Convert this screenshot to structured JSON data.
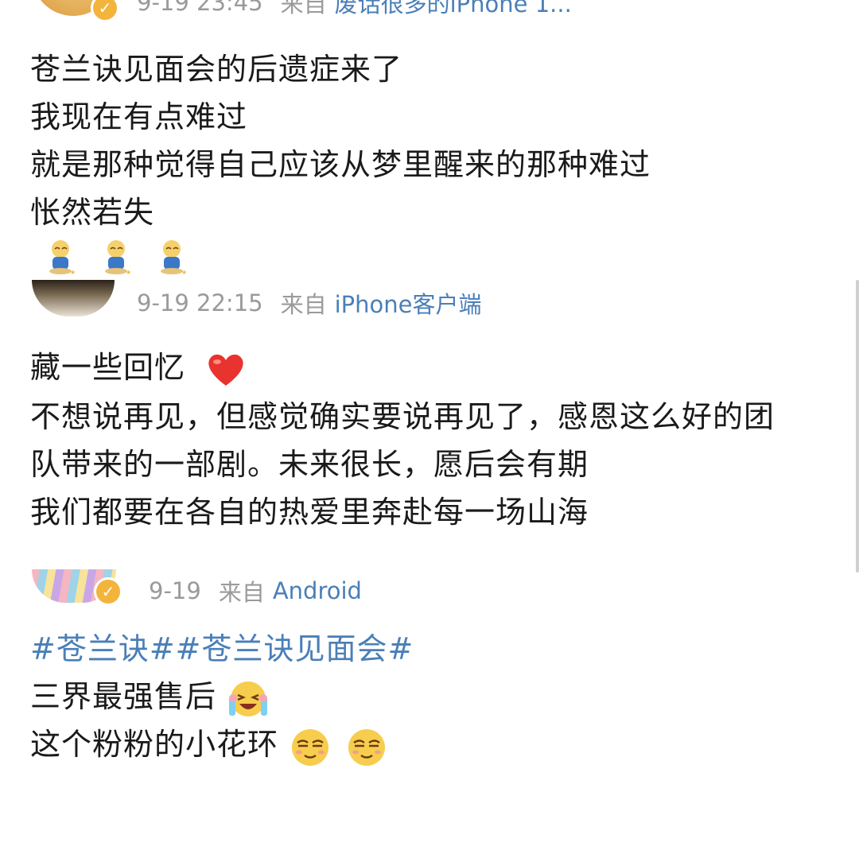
{
  "posts": [
    {
      "time": "9-19 23:45",
      "from": "来自",
      "source": "废话很多的iPhone 1...",
      "verified": true,
      "lines": [
        "苍兰诀见面会的后遗症来了",
        "我现在有点难过",
        "就是那种觉得自己应该从梦里醒来的那种难过",
        "怅然若失"
      ],
      "emojis": [
        "sleepy-doll-emoji",
        "sleepy-doll-emoji",
        "sleepy-doll-emoji"
      ]
    },
    {
      "time": "9-19 22:15",
      "from": "来自",
      "source": "iPhone客户端",
      "verified": false,
      "lines": [
        "藏一些回忆",
        "不想说再见，但感觉确实要说再见了，感恩这么好的团",
        "队带来的一部剧。未来很长，愿后会有期",
        "我们都要在各自的热爱里奔赴每一场山海"
      ],
      "emojis": [
        "red-heart-emoji"
      ]
    },
    {
      "time": "9-19",
      "from": "来自",
      "source": "Android",
      "verified": true,
      "topics": "#苍兰诀##苍兰诀见面会#",
      "lines": [
        "三界最强售后",
        "这个粉粉的小花环"
      ],
      "emojis": [
        "crying-laugh-emoji",
        "smirk-emoji",
        "smirk-emoji"
      ]
    }
  ],
  "colors": {
    "link": "#4a7fb8",
    "meta": "#9a9a9a",
    "text": "#1a1a1a",
    "badge": "#f3b43c"
  }
}
